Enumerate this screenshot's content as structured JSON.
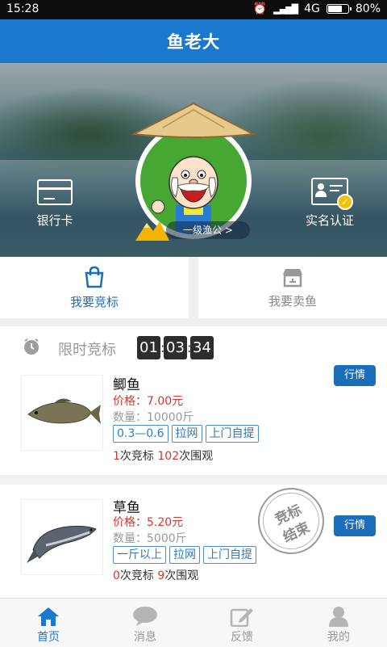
{
  "status_bar": {
    "time": "15:28",
    "network": "4G",
    "battery": "80%",
    "battery_level": 0.8
  },
  "header": {
    "title": "鱼老大"
  },
  "profile": {
    "bank_card_label": "银行卡",
    "verify_label": "实名认证",
    "level_label": "一级渔公 >"
  },
  "actions": [
    {
      "label": "我要竞标",
      "icon": "shopping-bag-icon",
      "active": true
    },
    {
      "label": "我要卖鱼",
      "icon": "shop-icon",
      "active": false
    }
  ],
  "auction": {
    "label": "限时竞标",
    "countdown": [
      "01",
      "03",
      "34"
    ]
  },
  "items": [
    {
      "name": "鲫鱼",
      "price": "价格：7.00元",
      "quantity": "数量：10000斤",
      "tags": [
        "0.3—0.6",
        "拉网",
        "上门自提"
      ],
      "bids": "1",
      "bids_label": "次竞标",
      "views": "102",
      "views_label": "次围观",
      "button": "行情"
    },
    {
      "name": "草鱼",
      "price": "价格：5.20元",
      "quantity": "数量：5000斤",
      "tags": [
        "一斤以上",
        "拉网",
        "上门自提"
      ],
      "bids": "0",
      "bids_label": "次竞标",
      "views": "9",
      "views_label": "次围观",
      "button": "行情",
      "stamp": [
        "竞标",
        "结束"
      ]
    }
  ],
  "tabs": [
    {
      "label": "首页",
      "icon": "home-icon",
      "active": true
    },
    {
      "label": "消息",
      "icon": "message-icon",
      "active": false
    },
    {
      "label": "反馈",
      "icon": "feedback-icon",
      "active": false
    },
    {
      "label": "我的",
      "icon": "user-icon",
      "active": false
    }
  ],
  "colors": {
    "primary": "#1a78cf",
    "price_red": "#d9342b",
    "tag_blue": "#2d79bf"
  }
}
